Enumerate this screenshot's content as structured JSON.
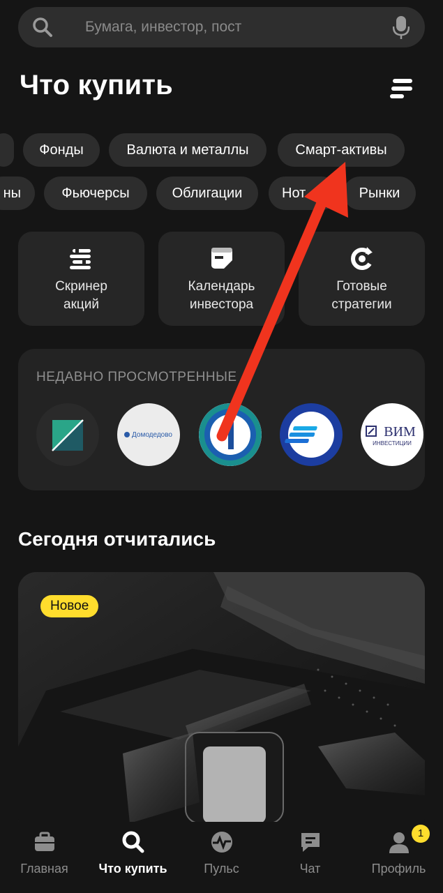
{
  "search": {
    "placeholder": "Бумага, инвестор, пост"
  },
  "page": {
    "title": "Что купить"
  },
  "chips_row1": [
    "Фонды",
    "Валюта и металлы",
    "Смарт-активы"
  ],
  "chips_row2": [
    "ны",
    "Фьючерсы",
    "Облигации",
    "Нот",
    "Рынки"
  ],
  "tiles": [
    {
      "label_line1": "Скринер",
      "label_line2": "акций"
    },
    {
      "label_line1": "Календарь",
      "label_line2": "инвестора"
    },
    {
      "label_line1": "Готовые",
      "label_line2": "стратегии"
    }
  ],
  "recent": {
    "title": "НЕДАВНО ПРОСМОТРЕННЫЕ",
    "logo_texts": {
      "domodedovo": "Домодедово",
      "vim_main": "ВИМ",
      "vim_sub": "ИНВЕСТИЦИИ"
    }
  },
  "section": {
    "title": "Сегодня отчитались"
  },
  "promo": {
    "badge": "Новое"
  },
  "nav": [
    {
      "label": "Главная",
      "icon": "briefcase-icon"
    },
    {
      "label": "Что купить",
      "icon": "search-icon"
    },
    {
      "label": "Пульс",
      "icon": "pulse-icon"
    },
    {
      "label": "Чат",
      "icon": "chat-icon"
    },
    {
      "label": "Профиль",
      "icon": "profile-icon",
      "badge": "1"
    }
  ],
  "colors": {
    "accent": "#ffdd2d",
    "arrow": "#f0341e",
    "background": "#151515"
  }
}
